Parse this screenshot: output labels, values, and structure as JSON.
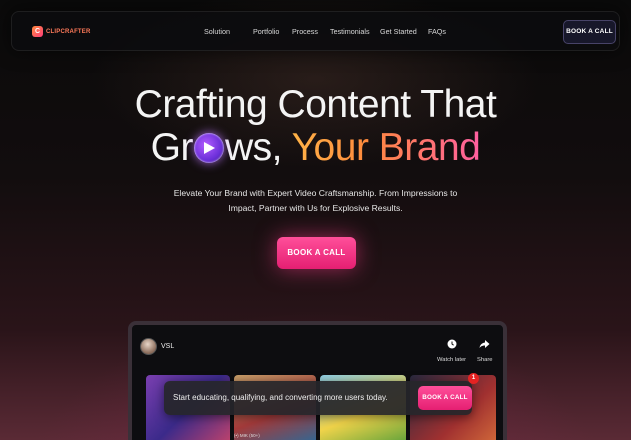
{
  "nav": {
    "logo_mark": "C",
    "logo_text": "CLIPCRAFTER",
    "links": [
      "Solution",
      "Portfolio",
      "Process",
      "Testimonials",
      "Get Started",
      "FAQs"
    ],
    "cta_label": "BOOK A CALL"
  },
  "hero": {
    "headline_line1": "Crafting Content That",
    "headline_line2_pre": "Gr",
    "headline_line2_post": "ws,",
    "headline_line2_accent": "Your Brand",
    "subtitle": "Elevate Your Brand with Expert Video Craftsmanship. From Impressions to Impact, Partner with Us for Explosive Results.",
    "cta_label": "BOOK A CALL"
  },
  "video": {
    "title": "VSL",
    "watch_later_label": "Watch later",
    "share_label": "Share",
    "overlay_text": "Start educating, qualifying, and converting more users today.",
    "overlay_cta_label": "BOOK A CALL",
    "notification_count": "1",
    "thumb_label": "(•) MIK (50+)"
  },
  "colors": {
    "accent_pink": "#e51f72",
    "brand_orange": "#ff8a3d",
    "play_purple": "#6a2fd8"
  },
  "icons": [
    "play-icon",
    "clock-icon",
    "share-icon"
  ]
}
